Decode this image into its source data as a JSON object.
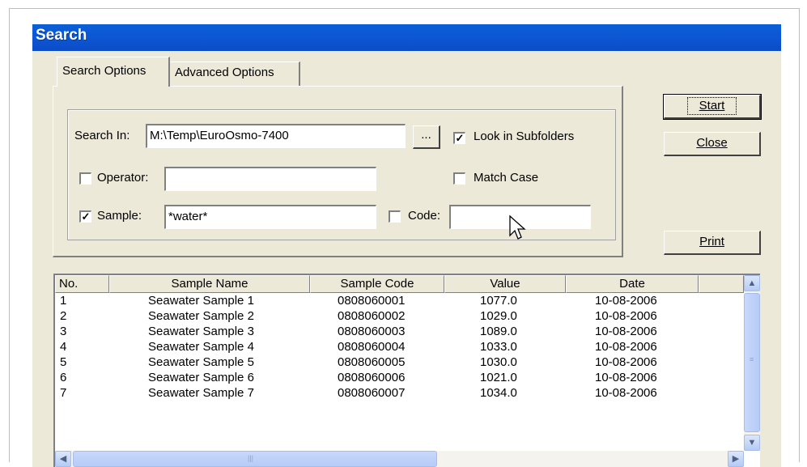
{
  "window": {
    "title": "Search"
  },
  "tabs": [
    {
      "label": "Search Options",
      "active": true
    },
    {
      "label": "Advanced Options",
      "active": false
    }
  ],
  "form": {
    "search_in_label": "Search In:",
    "search_in_value": "M:\\Temp\\EuroOsmo-7400",
    "browse_label": "...",
    "look_in_subfolders_label": "Look in Subfolders",
    "look_in_subfolders_checked": true,
    "operator_label": "Operator:",
    "operator_checked": false,
    "operator_value": "",
    "match_case_label": "Match Case",
    "match_case_checked": false,
    "sample_label": "Sample:",
    "sample_checked": true,
    "sample_value": "*water*",
    "code_label": "Code:",
    "code_checked": false,
    "code_value": ""
  },
  "buttons": {
    "start_label": "Start",
    "close_label": "Close",
    "print_label": "Print"
  },
  "results": {
    "columns": [
      "No.",
      "Sample Name",
      "Sample Code",
      "Value",
      "Date"
    ],
    "rows": [
      [
        "1",
        "Seawater Sample 1",
        "0808060001",
        "1077.0",
        "10-08-2006"
      ],
      [
        "2",
        "Seawater Sample 2",
        "0808060002",
        "1029.0",
        "10-08-2006"
      ],
      [
        "3",
        "Seawater Sample 3",
        "0808060003",
        "1089.0",
        "10-08-2006"
      ],
      [
        "4",
        "Seawater Sample 4",
        "0808060004",
        "1033.0",
        "10-08-2006"
      ],
      [
        "5",
        "Seawater Sample 5",
        "0808060005",
        "1030.0",
        "10-08-2006"
      ],
      [
        "6",
        "Seawater Sample 6",
        "0808060006",
        "1021.0",
        "10-08-2006"
      ],
      [
        "7",
        "Seawater Sample 7",
        "0808060007",
        "1034.0",
        "10-08-2006"
      ]
    ]
  },
  "icons": {
    "scroll_up": "chevron-up-icon",
    "scroll_down": "chevron-down-icon",
    "scroll_left": "chevron-left-icon",
    "scroll_right": "chevron-right-icon",
    "cursor": "mouse-pointer-icon"
  },
  "colors": {
    "titlebar": "#0c55d2",
    "dialog_bg": "#ece9d8",
    "scrollbar_thumb": "#c1d3fb"
  }
}
